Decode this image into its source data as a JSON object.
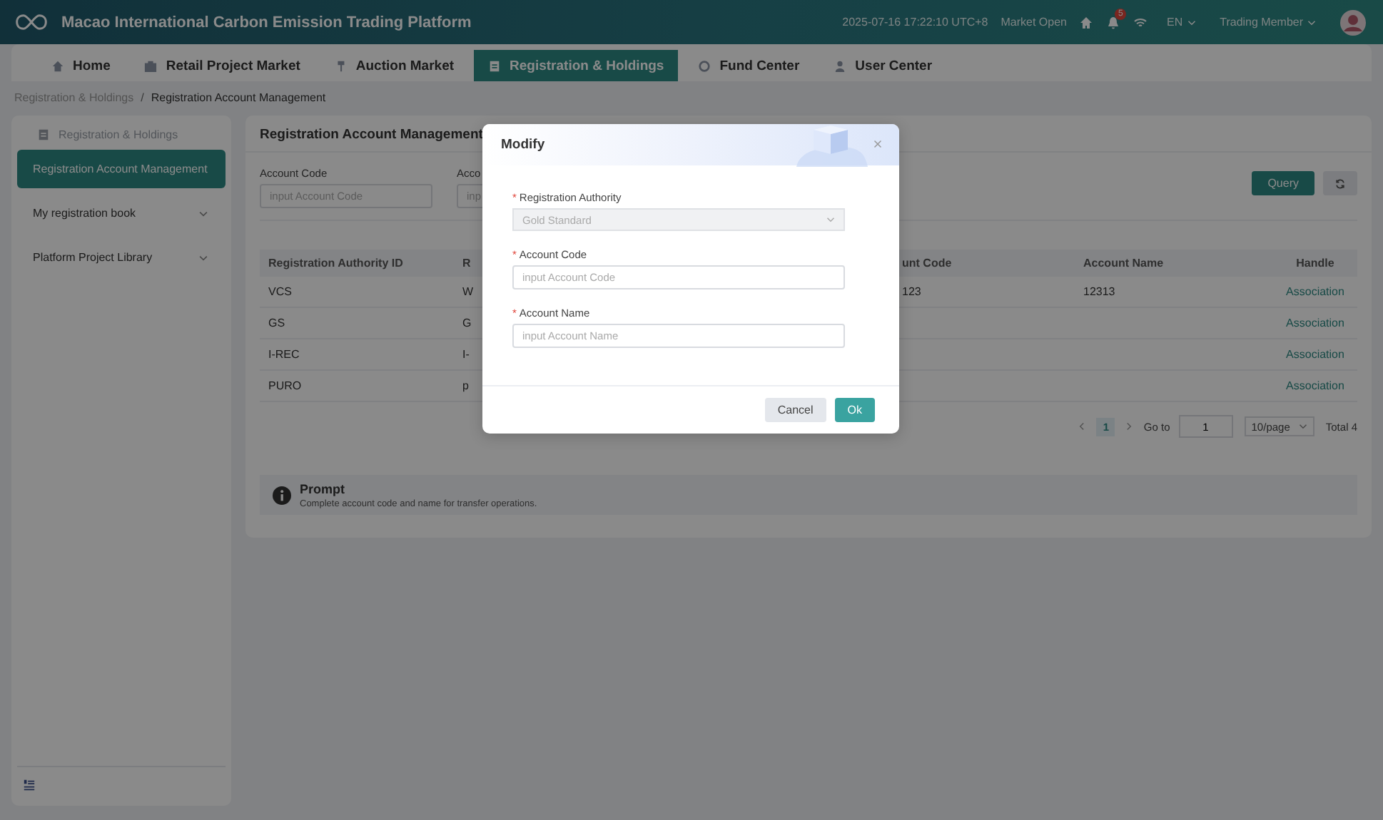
{
  "header": {
    "title": "Macao International Carbon Emission Trading Platform",
    "datetime": "2025-07-16 17:22:10 UTC+8",
    "market_status": "Market Open",
    "notifications": "5",
    "language": "EN",
    "user_role": "Trading Member"
  },
  "nav_tabs": [
    {
      "label": "Home",
      "selected": false
    },
    {
      "label": "Retail Project Market",
      "selected": false
    },
    {
      "label": "Auction Market",
      "selected": false
    },
    {
      "label": "Registration & Holdings",
      "selected": true
    },
    {
      "label": "Fund Center",
      "selected": false
    },
    {
      "label": "User Center",
      "selected": false
    }
  ],
  "breadcrumb": [
    "Registration & Holdings",
    "Registration Account Management"
  ],
  "breadcrumb_separator": "/",
  "sidebar": {
    "title": "Registration & Holdings",
    "items": [
      {
        "label": "Registration Account Management",
        "selected": true,
        "expandable": false
      },
      {
        "label": "My registration book",
        "selected": false,
        "expandable": true
      },
      {
        "label": "Platform Project Library",
        "selected": false,
        "expandable": true
      }
    ]
  },
  "panel": {
    "title": "Registration Account Management",
    "filters": [
      {
        "label": "Account Code",
        "placeholder": "input Account Code"
      },
      {
        "label": "Acco",
        "placeholder": "inp"
      }
    ],
    "query_button": "Query"
  },
  "table": {
    "columns": [
      "Registration Authority ID",
      "R",
      "unt Code",
      "Account Name",
      "Handle"
    ],
    "rows": [
      {
        "authority_id": "VCS",
        "column_2": "W",
        "account_code": "123",
        "account_name": "12313",
        "action": "Association"
      },
      {
        "authority_id": "GS",
        "column_2": "G",
        "action": "Association"
      },
      {
        "authority_id": "I-REC",
        "column_2": "I-",
        "action": "Association"
      },
      {
        "authority_id": "PURO",
        "column_2": "p",
        "action": "Association"
      }
    ]
  },
  "pagination": {
    "pages": [
      {
        "label": "1",
        "selected": true
      }
    ],
    "goto_label": "Go to",
    "goto_value": "1",
    "page_size": "10/page",
    "total": "Total 4"
  },
  "prompt": {
    "title": "Prompt",
    "text": "Complete account code and name for transfer operations."
  },
  "modal": {
    "title": "Modify",
    "fields": [
      {
        "kind": "select",
        "required_mark": "*",
        "label": "Registration Authority",
        "value": "Gold Standard",
        "disabled": true
      },
      {
        "kind": "input",
        "required_mark": "*",
        "label": "Account Code",
        "placeholder": "input Account Code"
      },
      {
        "kind": "input",
        "required_mark": "*",
        "label": "Account Name",
        "placeholder": "input Account Name"
      }
    ],
    "buttons": [
      {
        "label": "Cancel",
        "kind": "secondary"
      },
      {
        "label": "Ok",
        "kind": "primary"
      }
    ]
  }
}
